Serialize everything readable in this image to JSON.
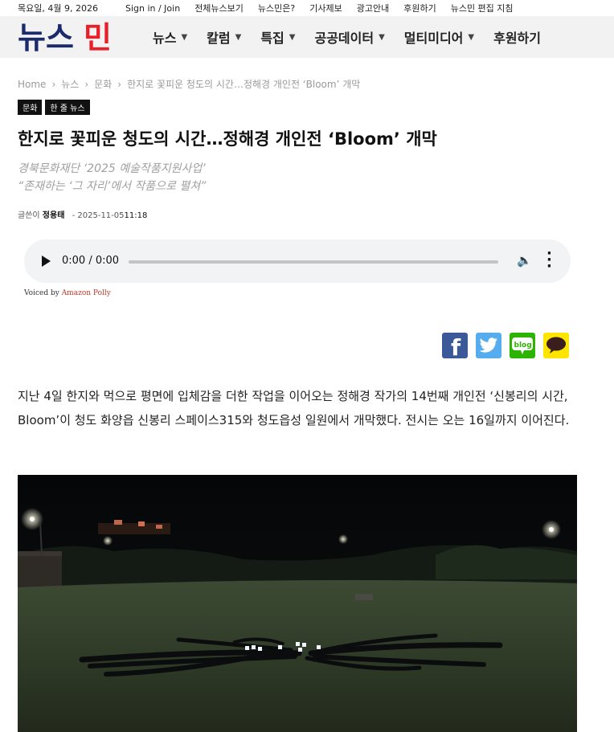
{
  "topbar": {
    "date": "목요일, 4월 9, 2026",
    "links": [
      "Sign in / Join",
      "전체뉴스보기",
      "뉴스민은?",
      "기사제보",
      "광고안내",
      "후원하기",
      "뉴스민 편집 지침"
    ]
  },
  "logo": {
    "text": "뉴스민",
    "color": "#e8202a"
  },
  "nav": [
    {
      "label": "뉴스"
    },
    {
      "label": "칼럼"
    },
    {
      "label": "특집"
    },
    {
      "label": "공공데이터"
    },
    {
      "label": "멀티미디어"
    },
    {
      "label": "후원하기"
    }
  ],
  "breadcrumb": [
    "Home",
    "뉴스",
    "문화",
    "한지로 꽃피운 청도의 시간…정해경 개인전 ‘Bloom’ 개막"
  ],
  "tags": [
    "문화",
    "한 줄 뉴스"
  ],
  "article": {
    "title": "한지로 꽃피운 청도의 시간…정해경 개인전 ‘Bloom’ 개막",
    "subtitle_lines": [
      "경북문화재단 ‘2025 예술작품지원사업’",
      "“존재하는 ‘그 자리’에서 작품으로 펼쳐”"
    ],
    "byline_label": "글쓴이",
    "author": "정용태",
    "date_sep": "-",
    "date": "2025-11-05",
    "time": "11:18",
    "body": "지난 4일 한지와 먹으로 평면에 입체감을 더한 작업을 이어오는 정해경 작가의 14번째 개인전 ‘신봉리의 시간, Bloom’이 청도 화양읍 신봉리 스페이스315와 청도읍성 일원에서 개막했다. 전시는 오는 16일까지 이어진다."
  },
  "audio": {
    "time": "0:00 / 0:00"
  },
  "voiced": {
    "prefix": "Voiced by",
    "provider": "Amazon Polly"
  },
  "social": [
    {
      "icon": "facebook-icon",
      "glyph": "f",
      "color": "#3b5998"
    },
    {
      "icon": "twitter-icon",
      "glyph": "t",
      "color": "#55acee"
    },
    {
      "icon": "blog-icon",
      "glyph": "blog",
      "color": "#2db400"
    },
    {
      "icon": "kakao-icon",
      "glyph": "",
      "color": "#fee500"
    }
  ]
}
